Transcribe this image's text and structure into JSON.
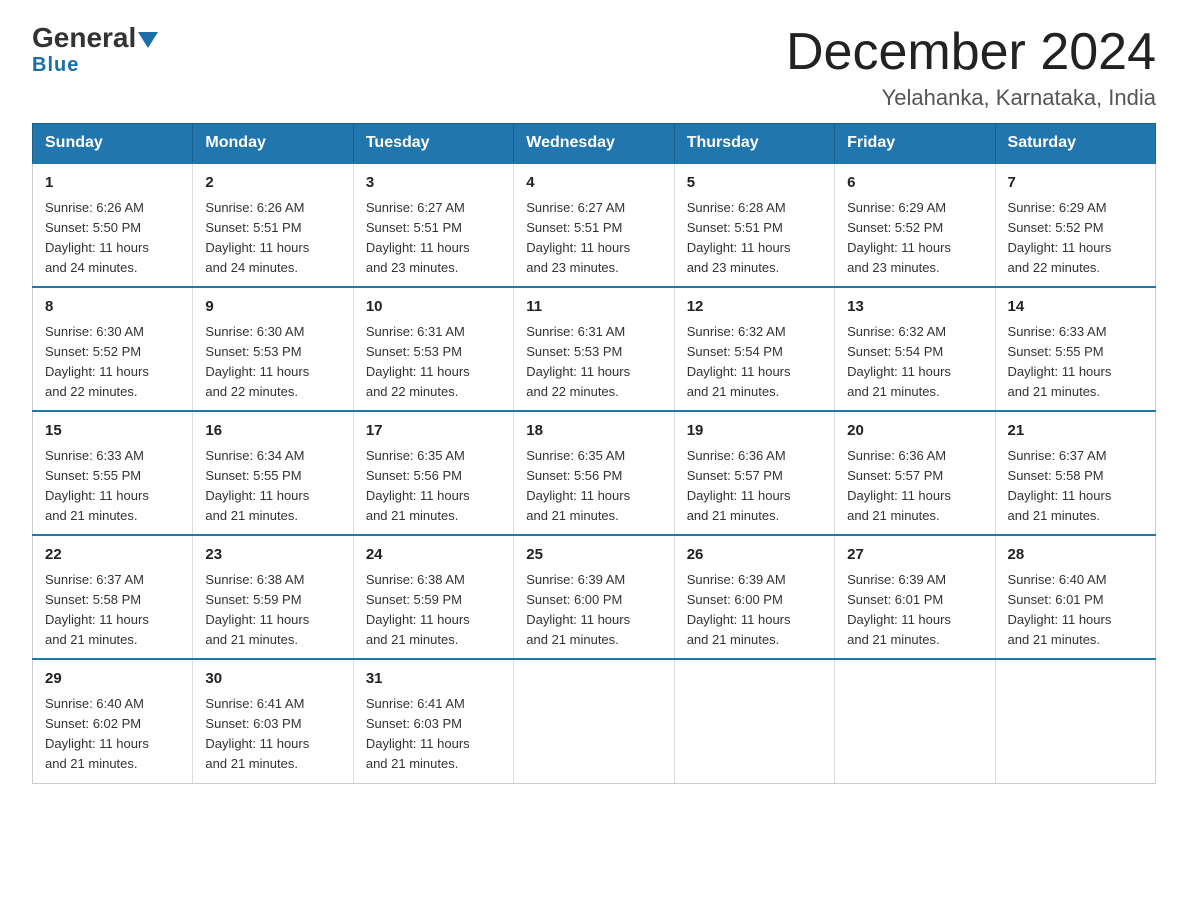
{
  "logo": {
    "text_general": "General",
    "text_blue": "Blue",
    "arrow": "▲"
  },
  "header": {
    "title": "December 2024",
    "subtitle": "Yelahanka, Karnataka, India"
  },
  "calendar": {
    "days_of_week": [
      "Sunday",
      "Monday",
      "Tuesday",
      "Wednesday",
      "Thursday",
      "Friday",
      "Saturday"
    ],
    "weeks": [
      [
        {
          "day": "1",
          "info": "Sunrise: 6:26 AM\nSunset: 5:50 PM\nDaylight: 11 hours\nand 24 minutes."
        },
        {
          "day": "2",
          "info": "Sunrise: 6:26 AM\nSunset: 5:51 PM\nDaylight: 11 hours\nand 24 minutes."
        },
        {
          "day": "3",
          "info": "Sunrise: 6:27 AM\nSunset: 5:51 PM\nDaylight: 11 hours\nand 23 minutes."
        },
        {
          "day": "4",
          "info": "Sunrise: 6:27 AM\nSunset: 5:51 PM\nDaylight: 11 hours\nand 23 minutes."
        },
        {
          "day": "5",
          "info": "Sunrise: 6:28 AM\nSunset: 5:51 PM\nDaylight: 11 hours\nand 23 minutes."
        },
        {
          "day": "6",
          "info": "Sunrise: 6:29 AM\nSunset: 5:52 PM\nDaylight: 11 hours\nand 23 minutes."
        },
        {
          "day": "7",
          "info": "Sunrise: 6:29 AM\nSunset: 5:52 PM\nDaylight: 11 hours\nand 22 minutes."
        }
      ],
      [
        {
          "day": "8",
          "info": "Sunrise: 6:30 AM\nSunset: 5:52 PM\nDaylight: 11 hours\nand 22 minutes."
        },
        {
          "day": "9",
          "info": "Sunrise: 6:30 AM\nSunset: 5:53 PM\nDaylight: 11 hours\nand 22 minutes."
        },
        {
          "day": "10",
          "info": "Sunrise: 6:31 AM\nSunset: 5:53 PM\nDaylight: 11 hours\nand 22 minutes."
        },
        {
          "day": "11",
          "info": "Sunrise: 6:31 AM\nSunset: 5:53 PM\nDaylight: 11 hours\nand 22 minutes."
        },
        {
          "day": "12",
          "info": "Sunrise: 6:32 AM\nSunset: 5:54 PM\nDaylight: 11 hours\nand 21 minutes."
        },
        {
          "day": "13",
          "info": "Sunrise: 6:32 AM\nSunset: 5:54 PM\nDaylight: 11 hours\nand 21 minutes."
        },
        {
          "day": "14",
          "info": "Sunrise: 6:33 AM\nSunset: 5:55 PM\nDaylight: 11 hours\nand 21 minutes."
        }
      ],
      [
        {
          "day": "15",
          "info": "Sunrise: 6:33 AM\nSunset: 5:55 PM\nDaylight: 11 hours\nand 21 minutes."
        },
        {
          "day": "16",
          "info": "Sunrise: 6:34 AM\nSunset: 5:55 PM\nDaylight: 11 hours\nand 21 minutes."
        },
        {
          "day": "17",
          "info": "Sunrise: 6:35 AM\nSunset: 5:56 PM\nDaylight: 11 hours\nand 21 minutes."
        },
        {
          "day": "18",
          "info": "Sunrise: 6:35 AM\nSunset: 5:56 PM\nDaylight: 11 hours\nand 21 minutes."
        },
        {
          "day": "19",
          "info": "Sunrise: 6:36 AM\nSunset: 5:57 PM\nDaylight: 11 hours\nand 21 minutes."
        },
        {
          "day": "20",
          "info": "Sunrise: 6:36 AM\nSunset: 5:57 PM\nDaylight: 11 hours\nand 21 minutes."
        },
        {
          "day": "21",
          "info": "Sunrise: 6:37 AM\nSunset: 5:58 PM\nDaylight: 11 hours\nand 21 minutes."
        }
      ],
      [
        {
          "day": "22",
          "info": "Sunrise: 6:37 AM\nSunset: 5:58 PM\nDaylight: 11 hours\nand 21 minutes."
        },
        {
          "day": "23",
          "info": "Sunrise: 6:38 AM\nSunset: 5:59 PM\nDaylight: 11 hours\nand 21 minutes."
        },
        {
          "day": "24",
          "info": "Sunrise: 6:38 AM\nSunset: 5:59 PM\nDaylight: 11 hours\nand 21 minutes."
        },
        {
          "day": "25",
          "info": "Sunrise: 6:39 AM\nSunset: 6:00 PM\nDaylight: 11 hours\nand 21 minutes."
        },
        {
          "day": "26",
          "info": "Sunrise: 6:39 AM\nSunset: 6:00 PM\nDaylight: 11 hours\nand 21 minutes."
        },
        {
          "day": "27",
          "info": "Sunrise: 6:39 AM\nSunset: 6:01 PM\nDaylight: 11 hours\nand 21 minutes."
        },
        {
          "day": "28",
          "info": "Sunrise: 6:40 AM\nSunset: 6:01 PM\nDaylight: 11 hours\nand 21 minutes."
        }
      ],
      [
        {
          "day": "29",
          "info": "Sunrise: 6:40 AM\nSunset: 6:02 PM\nDaylight: 11 hours\nand 21 minutes."
        },
        {
          "day": "30",
          "info": "Sunrise: 6:41 AM\nSunset: 6:03 PM\nDaylight: 11 hours\nand 21 minutes."
        },
        {
          "day": "31",
          "info": "Sunrise: 6:41 AM\nSunset: 6:03 PM\nDaylight: 11 hours\nand 21 minutes."
        },
        {
          "day": "",
          "info": ""
        },
        {
          "day": "",
          "info": ""
        },
        {
          "day": "",
          "info": ""
        },
        {
          "day": "",
          "info": ""
        }
      ]
    ]
  }
}
